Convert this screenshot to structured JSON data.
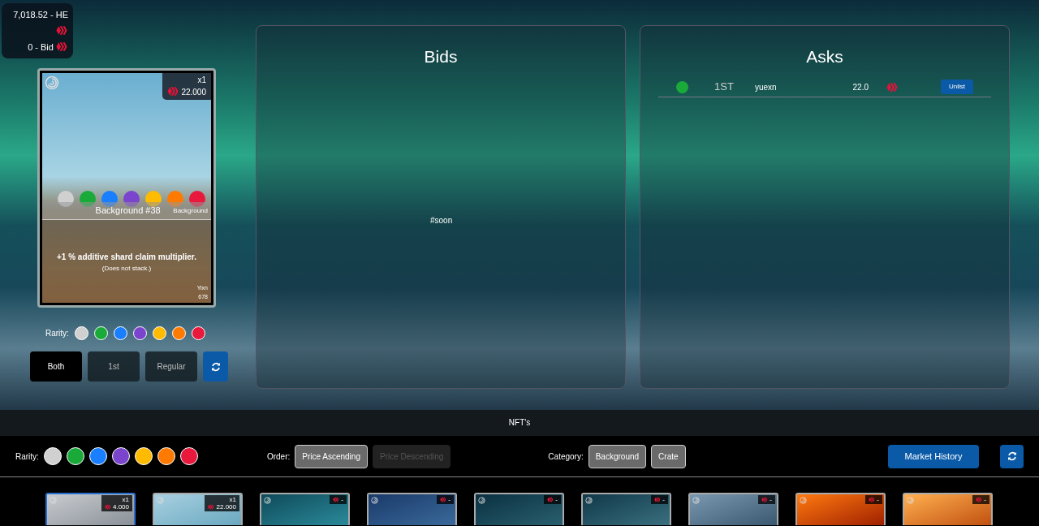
{
  "balance": {
    "he": "7,018.52 - HE",
    "bid": "0 - Bid"
  },
  "card": {
    "count": "x1",
    "price": "22.000",
    "rarity_dots": [
      {
        "color": "#d0d0d0"
      },
      {
        "color": "#1aaa3a"
      },
      {
        "color": "#1a7fff"
      },
      {
        "color": "#7a44cc"
      },
      {
        "color": "#ffbb00"
      },
      {
        "color": "#ff7a00"
      },
      {
        "color": "#e8193c"
      }
    ],
    "title": "Background #38",
    "category": "Background",
    "description": "+1 % additive shard claim multiplier.",
    "note": "(Does not stack.)",
    "artist": "Yixn",
    "number": "678"
  },
  "rarity_filter": {
    "label": "Rarity:",
    "options": [
      {
        "color": "#d0d0d0",
        "selected": false
      },
      {
        "color": "#1aaa3a",
        "selected": false
      },
      {
        "color": "#1a7fff",
        "selected": false
      },
      {
        "color": "#7a44cc",
        "selected": false
      },
      {
        "color": "#ffbb00",
        "selected": false
      },
      {
        "color": "#ff7a00",
        "selected": false
      },
      {
        "color": "#e8193c",
        "selected": false
      }
    ]
  },
  "edition_buttons": [
    {
      "label": "Both",
      "selected": true
    },
    {
      "label": "1st",
      "selected": false
    },
    {
      "label": "Regular",
      "selected": false
    }
  ],
  "bids": {
    "title": "Bids",
    "message": "#soon"
  },
  "asks": {
    "title": "Asks",
    "rows": [
      {
        "color": "#1aaa3a",
        "edition": "1ST",
        "seller": "yuexn",
        "price": "22.0",
        "action": "Unlist"
      }
    ]
  },
  "nfts": {
    "title": "NFT's",
    "rarity_label": "Rarity:",
    "rarity_options": [
      {
        "color": "#d0d0d0",
        "selected": false
      },
      {
        "color": "#1aaa3a",
        "selected": false
      },
      {
        "color": "#1a7fff",
        "selected": false
      },
      {
        "color": "#7a44cc",
        "selected": false
      },
      {
        "color": "#ffbb00",
        "selected": false
      },
      {
        "color": "#ff7a00",
        "selected": false
      },
      {
        "color": "#e8193c",
        "selected": false
      }
    ],
    "order_label": "Order:",
    "order": [
      {
        "label": "Price Ascending",
        "selected": true
      },
      {
        "label": "Price Descending",
        "selected": false
      }
    ],
    "category_label": "Category:",
    "categories": [
      {
        "label": "Background",
        "selected": true
      },
      {
        "label": "Crate",
        "selected": true
      }
    ],
    "market_history": "Market History",
    "items": [
      {
        "count": "x1",
        "price": "4.000",
        "selected": true
      },
      {
        "count": "x1",
        "price": "22.000",
        "selected": false
      },
      {
        "price": "-",
        "selected": false
      },
      {
        "price": "-",
        "selected": false
      },
      {
        "price": "-",
        "selected": false
      },
      {
        "price": "-",
        "selected": false
      },
      {
        "price": "-",
        "selected": false
      },
      {
        "price": "-",
        "selected": false
      },
      {
        "price": "-",
        "selected": false
      }
    ]
  }
}
